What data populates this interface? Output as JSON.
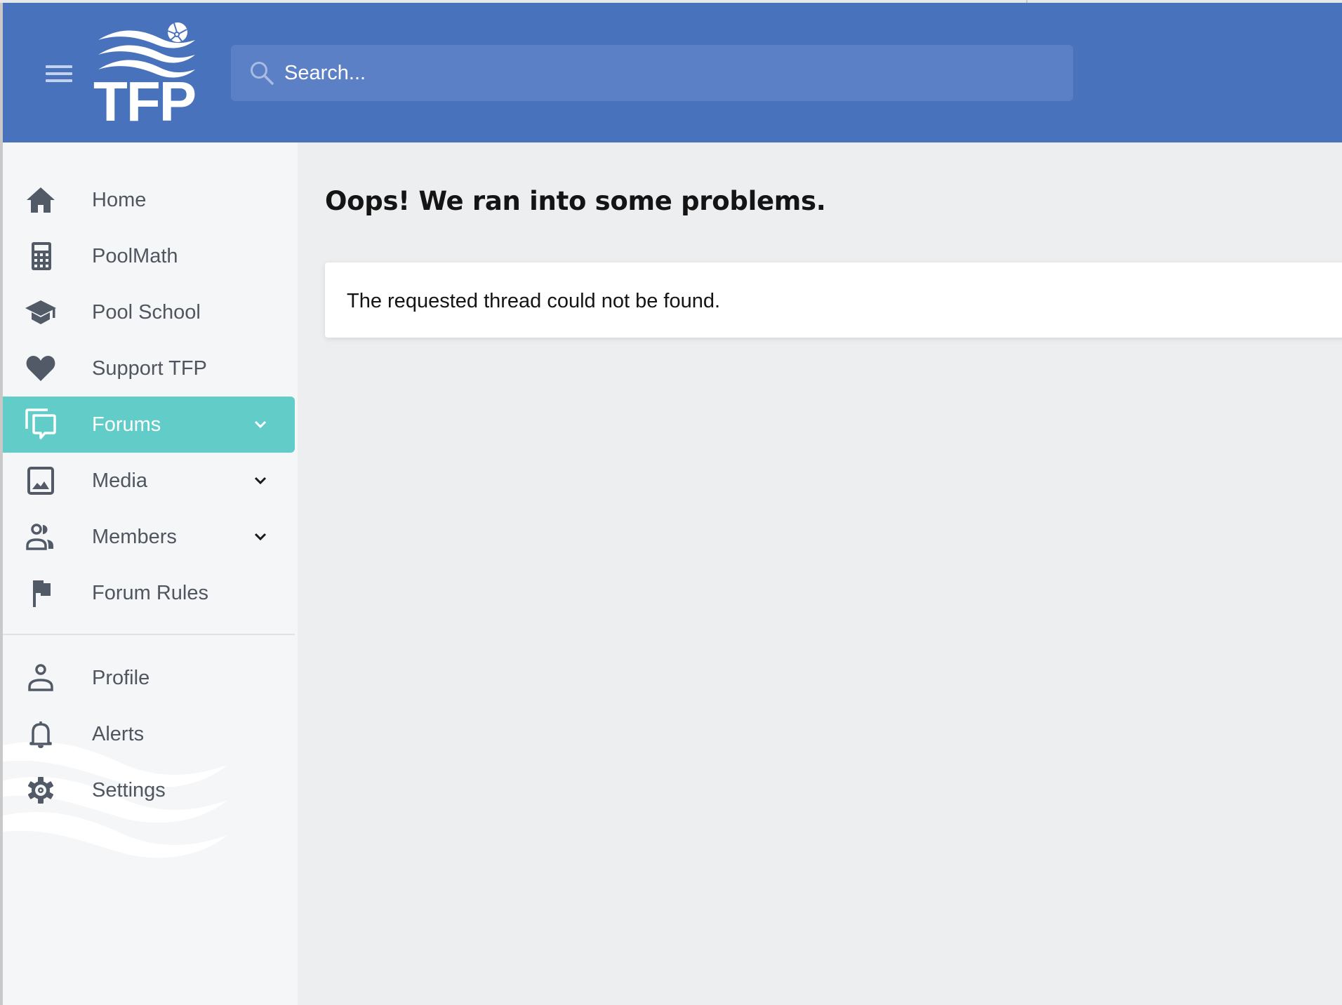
{
  "header": {
    "menu_icon": "hamburger-icon",
    "logo": {
      "text": "TFP",
      "icon": "waves-beachball-logo"
    },
    "search": {
      "placeholder": "Search...",
      "value": "",
      "icon": "search-icon"
    }
  },
  "sidebar": {
    "primary_items": [
      {
        "label": "Home",
        "icon": "home-icon",
        "active": false,
        "expandable": false
      },
      {
        "label": "PoolMath",
        "icon": "calculator-icon",
        "active": false,
        "expandable": false
      },
      {
        "label": "Pool School",
        "icon": "graduation-cap-icon",
        "active": false,
        "expandable": false
      },
      {
        "label": "Support TFP",
        "icon": "heart-icon",
        "active": false,
        "expandable": false
      },
      {
        "label": "Forums",
        "icon": "forums-icon",
        "active": true,
        "expandable": true
      },
      {
        "label": "Media",
        "icon": "image-icon",
        "active": false,
        "expandable": true
      },
      {
        "label": "Members",
        "icon": "members-icon",
        "active": false,
        "expandable": true
      },
      {
        "label": "Forum Rules",
        "icon": "flag-icon",
        "active": false,
        "expandable": false
      }
    ],
    "secondary_items": [
      {
        "label": "Profile",
        "icon": "user-icon"
      },
      {
        "label": "Alerts",
        "icon": "bell-icon"
      },
      {
        "label": "Settings",
        "icon": "gear-icon"
      }
    ]
  },
  "main": {
    "title": "Oops! We ran into some problems.",
    "error_message": "The requested thread could not be found."
  },
  "colors": {
    "header_bg": "#4873bc",
    "search_bg": "#5c80c6",
    "active_nav_bg": "#62ccc8",
    "sidebar_bg": "#f5f6f8",
    "main_bg": "#edeef0",
    "nav_text": "#4f5660",
    "icon": "#515a66"
  }
}
